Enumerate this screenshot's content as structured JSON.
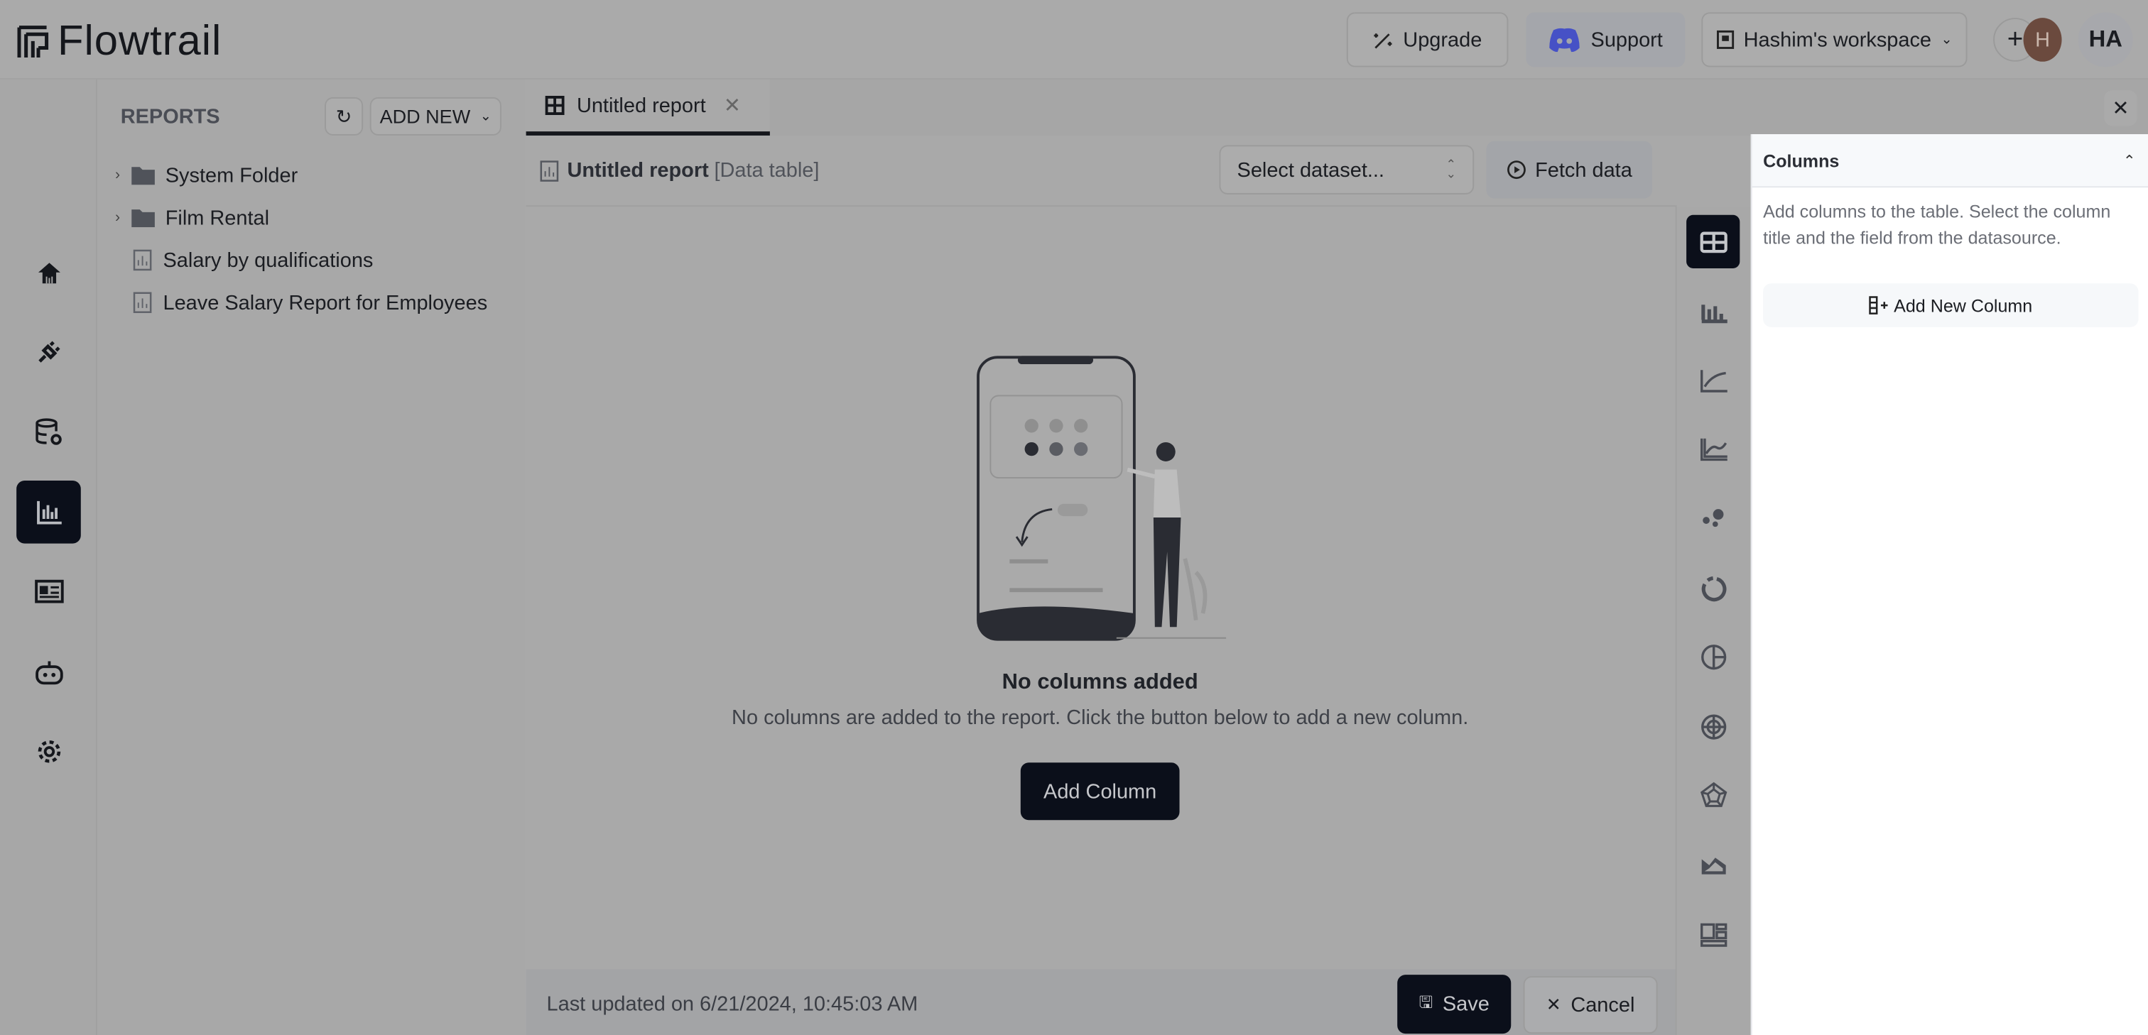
{
  "app": {
    "name": "Flowtrail"
  },
  "header": {
    "upgrade": "Upgrade",
    "support": "Support",
    "workspace": "Hashim's workspace",
    "avatar_initial": "H",
    "user_initials": "HA"
  },
  "nav": [
    {
      "icon": "home-icon"
    },
    {
      "icon": "plug-icon"
    },
    {
      "icon": "database-settings-icon"
    },
    {
      "icon": "reports-icon",
      "active": true
    },
    {
      "icon": "dashboard-icon"
    },
    {
      "icon": "bot-icon"
    },
    {
      "icon": "gear-icon"
    }
  ],
  "reports": {
    "title": "REPORTS",
    "add_new": "ADD NEW",
    "items": [
      {
        "label": "System Folder",
        "type": "folder"
      },
      {
        "label": "Film Rental",
        "type": "folder"
      },
      {
        "label": "Salary by qualifications",
        "type": "report"
      },
      {
        "label": "Leave Salary Report for Employees",
        "type": "report"
      }
    ]
  },
  "tab": {
    "label": "Untitled report"
  },
  "report": {
    "title": "Untitled report",
    "type": "[Data table]",
    "dataset_placeholder": "Select dataset...",
    "fetch": "Fetch data"
  },
  "empty": {
    "title": "No columns added",
    "message": "No columns are added to the report. Click the button below to add a new column.",
    "button": "Add Column"
  },
  "chart_types": [
    "table",
    "bar",
    "line",
    "multi-line",
    "scatter",
    "donut",
    "pie",
    "radial",
    "radar",
    "area",
    "layout"
  ],
  "panel": {
    "title": "Columns",
    "description": "Add columns to the table. Select the column title and the field from the datasource.",
    "add": "Add New Column"
  },
  "footer": {
    "last_updated": "Last updated on 6/21/2024, 10:45:03 AM",
    "save": "Save",
    "cancel": "Cancel"
  },
  "colors": {
    "dark": "#0b0f1a",
    "overlay": "#a9a9a9",
    "panel": "#ffffff",
    "discord": "#5865f2"
  }
}
